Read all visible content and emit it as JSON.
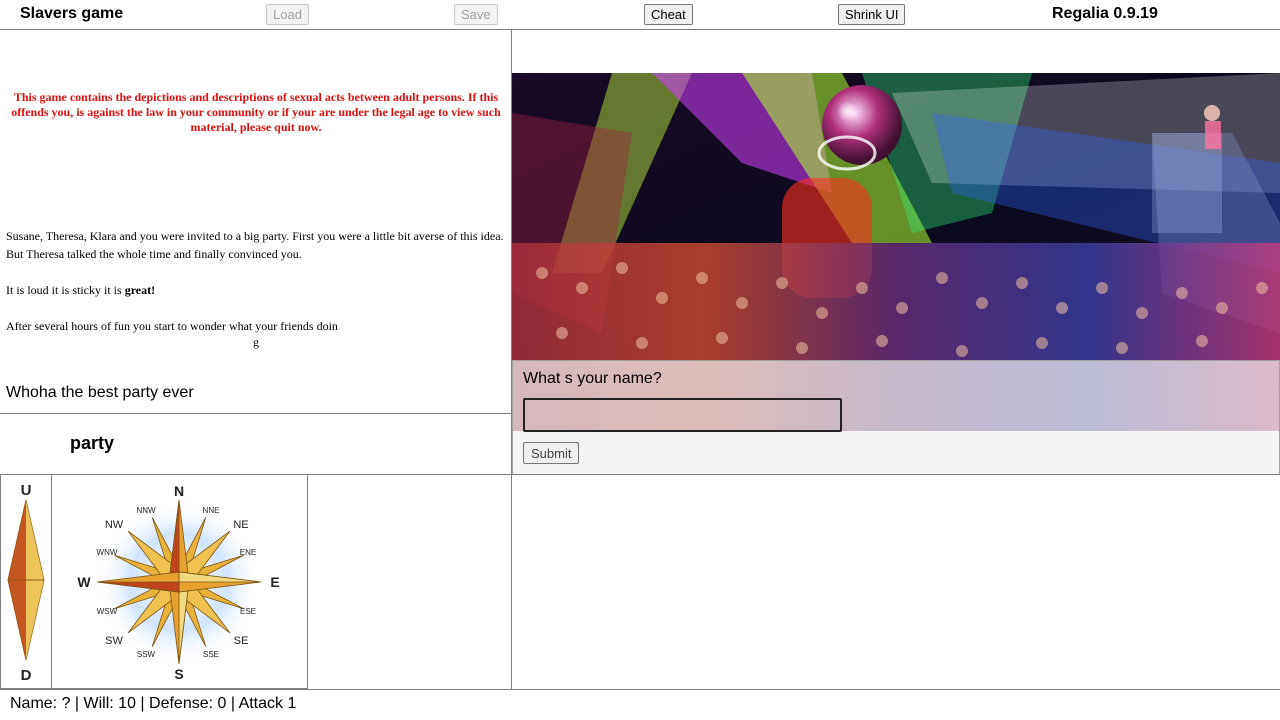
{
  "app": {
    "title": "Slavers game",
    "version": "Regalia 0.9.19"
  },
  "toolbar": {
    "load_label": "Load",
    "save_label": "Save",
    "cheat_label": "Cheat",
    "shrink_label": "Shrink UI"
  },
  "content": {
    "warning": "This game contains the depictions and descriptions of sexual acts between adult persons. If this offends you, is against the law in your community or if your are under the legal age to view such material, please quit now.",
    "story_p1": "Susane, Theresa, Klara and you were invited to a big party. First you were a little bit averse of this idea. But Theresa talked the whole time and finally convinced you.",
    "story_p2_prefix": "It is loud it is sticky it is ",
    "story_p2_bold": "great!",
    "story_p3": "After several hours of fun you start to wonder what your friends doin",
    "story_p3_tail": "g",
    "scene_title": "Whoha the best party ever",
    "location_name": "party"
  },
  "dialog": {
    "question": "What s your name?",
    "input_value": "",
    "submit_label": "Submit"
  },
  "compass": {
    "up": "U",
    "down": "D",
    "n": "N",
    "nne": "NNE",
    "ne": "NE",
    "ene": "ENE",
    "e": "E",
    "ese": "ESE",
    "se": "SE",
    "sse": "SSE",
    "s": "S",
    "ssw": "SSW",
    "sw": "SW",
    "wsw": "WSW",
    "w": "W",
    "wnw": "WNW",
    "nw": "NW",
    "nnw": "NNW"
  },
  "status": {
    "text": "Name: ? | Will: 10 | Defense: 0 | Attack 1"
  },
  "colors": {
    "warning": "#e01010",
    "compass_gold": "#e8b23a",
    "compass_red": "#c0451c"
  }
}
